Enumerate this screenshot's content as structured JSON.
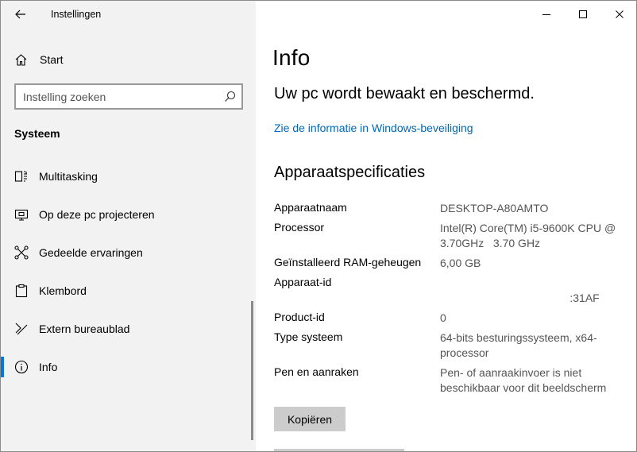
{
  "window": {
    "app_title": "Instellingen",
    "controls": [
      "minimize-icon",
      "maximize-icon",
      "close-icon"
    ]
  },
  "sidebar": {
    "back_icon": "back-arrow-icon",
    "home": {
      "label": "Start",
      "icon": "home-icon"
    },
    "search": {
      "placeholder": "Instelling zoeken",
      "icon": "search-icon"
    },
    "section_title": "Systeem",
    "items": [
      {
        "label": "Multitasking",
        "icon": "multitasking-icon",
        "selected": false
      },
      {
        "label": "Op deze pc projecteren",
        "icon": "project-icon",
        "selected": false
      },
      {
        "label": "Gedeelde ervaringen",
        "icon": "shared-experiences-icon",
        "selected": false
      },
      {
        "label": "Klembord",
        "icon": "clipboard-icon",
        "selected": false
      },
      {
        "label": "Extern bureaublad",
        "icon": "remote-desktop-icon",
        "selected": false
      },
      {
        "label": "Info",
        "icon": "info-icon",
        "selected": true
      }
    ]
  },
  "main": {
    "title": "Info",
    "status": "Uw pc wordt bewaakt en beschermd.",
    "security_link": "Zie de informatie in Windows-beveiliging",
    "specs_title": "Apparaatspecificaties",
    "specs": [
      {
        "key": "Apparaatnaam",
        "value": "DESKTOP-A80AMTO"
      },
      {
        "key": "Processor",
        "value": "Intel(R) Core(TM) i5-9600K CPU @ 3.70GHz   3.70 GHz"
      },
      {
        "key": "Geïnstalleerd RAM-geheugen",
        "value": "6,00 GB"
      },
      {
        "key": "Apparaat-id",
        "value": " \n                                          :31AF"
      },
      {
        "key": "Product-id",
        "value": "0"
      },
      {
        "key": "Type systeem",
        "value": "64-bits besturingssysteem, x64-processor"
      },
      {
        "key": "Pen en aanraken",
        "value": "Pen- of aanraakinvoer is niet beschikbaar voor dit beeldscherm"
      }
    ],
    "copy_button": "Kopiëren"
  },
  "colors": {
    "accent": "#0078d7",
    "link": "#0067b8",
    "sidebar_bg": "#f2f2f2",
    "button_bg": "#cccccc"
  }
}
